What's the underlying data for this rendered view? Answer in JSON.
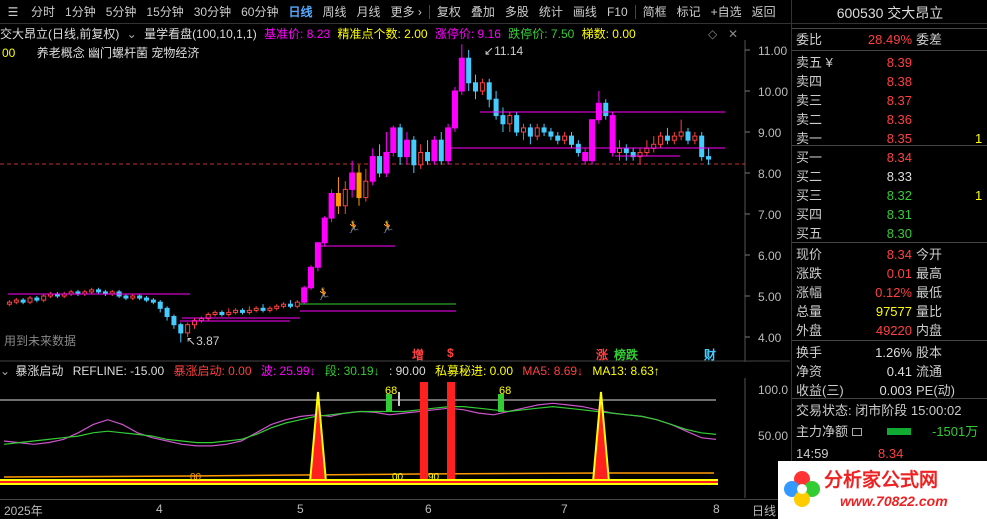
{
  "toolbar": {
    "items": [
      "分时",
      "1分钟",
      "5分钟",
      "15分钟",
      "30分钟",
      "60分钟",
      "日线",
      "周线",
      "月线",
      "更多 ›",
      "复权",
      "叠加",
      "多股",
      "统计",
      "画线",
      "F10",
      "简框",
      "标记",
      "+自选",
      "返回"
    ],
    "active": "日线"
  },
  "chart_head": {
    "name": "交大昂立(日线,前复权)",
    "indicator": "量学看盘(100,10,1,1)",
    "base_price": "基准价: 8.23",
    "precise_count": "精准点个数: 2.00",
    "limit_up": "涨停价: 9.16",
    "limit_down": "跌停价: 7.50",
    "ladder": "梯数: 0.00"
  },
  "concepts": {
    "prefix": "00",
    "text": "养老概念 幽门螺杆菌 宠物经济"
  },
  "price_axis": [
    "11.00",
    "10.00",
    "9.00",
    "8.00",
    "7.00",
    "6.00",
    "5.00",
    "4.00"
  ],
  "annotations": {
    "high": "11.14",
    "low": "3.87",
    "future": "用到未来数据"
  },
  "event_markers": [
    {
      "text": "增",
      "color": "#ff4040"
    },
    {
      "text": "$",
      "color": "#ff4040"
    },
    {
      "text": "涨",
      "color": "#ff4040"
    },
    {
      "text": "榜跌",
      "color": "#3c3"
    },
    {
      "text": "财",
      "color": "#4cf"
    }
  ],
  "ind_head": {
    "name": "暴涨启动",
    "refline": "REFLINE: -15.00",
    "boom": "暴涨启动: 0.00",
    "wave": "波: 25.99↓",
    "seg": "段: 30.19↓",
    "blank": ": 90.00",
    "private": "私募秘进: 0.00",
    "ma5": "MA5: 8.69↓",
    "ma13": "MA13: 8.63↑"
  },
  "ind_axis": [
    "100.0",
    "50.00"
  ],
  "ind_labels": [
    "68",
    "68",
    "00",
    "00",
    "90"
  ],
  "date_axis": [
    "2025年",
    "4",
    "5",
    "6",
    "7",
    "8"
  ],
  "date_mode": "日线",
  "quote": {
    "code": "600530",
    "name": "交大昂立",
    "webi_label": "委比",
    "webi_value": "28.49%",
    "weicha_label": "委差",
    "sells": [
      {
        "label": "卖五 ¥",
        "price": "8.39"
      },
      {
        "label": "卖四",
        "price": "8.38"
      },
      {
        "label": "卖三",
        "price": "8.37"
      },
      {
        "label": "卖二",
        "price": "8.36"
      },
      {
        "label": "卖一",
        "price": "8.35",
        "extra": "1"
      }
    ],
    "buys": [
      {
        "label": "买一",
        "price": "8.34"
      },
      {
        "label": "买二",
        "price": "8.33"
      },
      {
        "label": "买三",
        "price": "8.32",
        "extra": "1"
      },
      {
        "label": "买四",
        "price": "8.31"
      },
      {
        "label": "买五",
        "price": "8.30"
      }
    ],
    "stats": [
      {
        "l": "现价",
        "v": "8.34",
        "c": "red",
        "l2": "今开"
      },
      {
        "l": "涨跌",
        "v": "0.01",
        "c": "red",
        "l2": "最高"
      },
      {
        "l": "涨幅",
        "v": "0.12%",
        "c": "red",
        "l2": "最低"
      },
      {
        "l": "总量",
        "v": "97577",
        "c": "yel",
        "l2": "量比"
      },
      {
        "l": "外盘",
        "v": "49220",
        "c": "red",
        "l2": "内盘"
      }
    ],
    "stats2": [
      {
        "l": "换手",
        "v": "1.26%",
        "l2": "股本"
      },
      {
        "l": "净资",
        "v": "0.41",
        "l2": "流通"
      },
      {
        "l": "收益(三)",
        "v": "0.003",
        "l2": "PE(动)"
      }
    ],
    "trade_status": "交易状态: 闭市阶段 15:00:02",
    "main_flow_label": "主力净额",
    "main_flow_value": "-1501万",
    "tick_time": "14:59",
    "tick_price": "8.34"
  },
  "watermark": {
    "title": "分析家公式网",
    "url": "www.70822.com"
  },
  "colors": {
    "up": "#ff4040",
    "down": "#3cf",
    "magenta": "#ff00ff",
    "orange": "#ff9900"
  }
}
